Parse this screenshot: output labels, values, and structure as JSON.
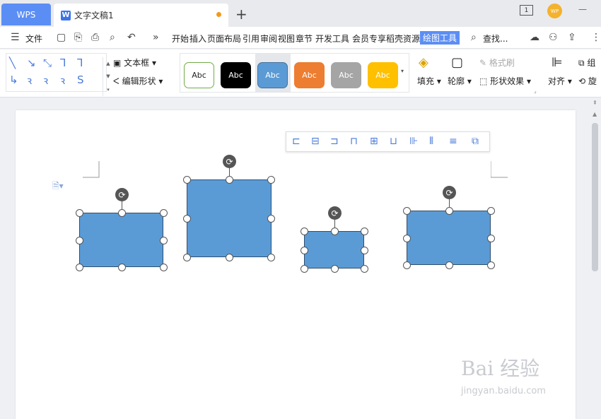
{
  "tabs": {
    "wps_label": "WPS",
    "doc_label": "文字文稿1",
    "doc_icon": "W",
    "new_tab": "+"
  },
  "window": {
    "screen_badge": "1",
    "avatar_text": "WP",
    "minimize": "—"
  },
  "menu": {
    "hamburger": "☰",
    "file": "文件",
    "overflow": "»",
    "items": [
      "开始",
      "插入",
      "页面布局",
      "引用",
      "审阅",
      "视图",
      "章节",
      "开发工具",
      "会员专享",
      "稻壳资源"
    ],
    "active": "绘图工具",
    "search": "查找..."
  },
  "ribbon": {
    "textbox": "文本框",
    "edit_shape": "编辑形状",
    "swatch_labels": [
      "Abc",
      "Abc",
      "Abc",
      "Abc",
      "Abc",
      "Abc"
    ],
    "fill": "填充",
    "outline": "轮廓",
    "format_painter": "格式刷",
    "shape_effect": "形状效果",
    "align": "对齐",
    "group": "组",
    "rotate": "旋"
  },
  "colors": {
    "accent": "#5b8ef5",
    "shape_fill": "#5b9bd5",
    "swatch_white": "#ffffff",
    "swatch_black": "#000000",
    "swatch_blue": "#5b9bd5",
    "swatch_orange": "#ed7d31",
    "swatch_gray": "#a5a5a5",
    "swatch_gold": "#ffc000"
  },
  "watermark": {
    "brand": "Bai 经验",
    "url": "jingyan.baidu.com"
  }
}
